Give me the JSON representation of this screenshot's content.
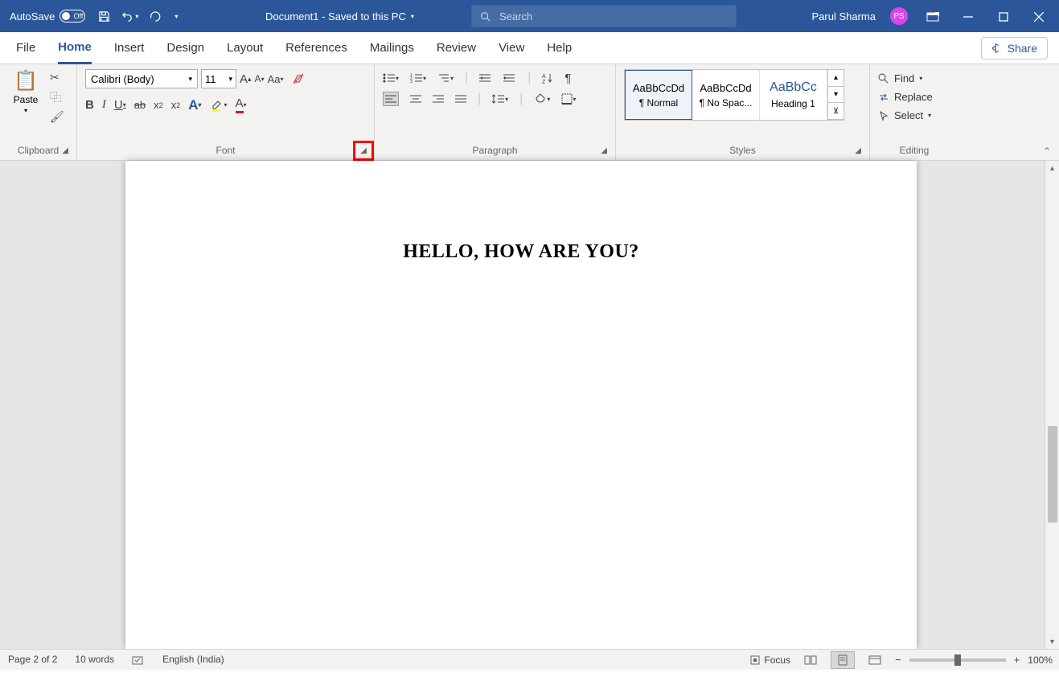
{
  "titlebar": {
    "autosave_label": "AutoSave",
    "autosave_state": "Off",
    "document_title": "Document1 - Saved to this PC",
    "search_placeholder": "Search",
    "user_name": "Parul Sharma",
    "user_initials": "PS"
  },
  "tabs": {
    "items": [
      "File",
      "Home",
      "Insert",
      "Design",
      "Layout",
      "References",
      "Mailings",
      "Review",
      "View",
      "Help"
    ],
    "active": "Home",
    "share_label": "Share"
  },
  "ribbon": {
    "clipboard": {
      "paste_label": "Paste",
      "group_label": "Clipboard"
    },
    "font": {
      "font_name": "Calibri (Body)",
      "font_size": "11",
      "group_label": "Font"
    },
    "paragraph": {
      "group_label": "Paragraph"
    },
    "styles": {
      "group_label": "Styles",
      "items": [
        {
          "preview": "AaBbCcDd",
          "name": "¶ Normal",
          "selected": true
        },
        {
          "preview": "AaBbCcDd",
          "name": "¶ No Spac...",
          "selected": false
        },
        {
          "preview": "AaBbCc",
          "name": "Heading 1",
          "selected": false
        }
      ]
    },
    "editing": {
      "group_label": "Editing",
      "find_label": "Find",
      "replace_label": "Replace",
      "select_label": "Select"
    }
  },
  "document": {
    "body_text": "HELLO, HOW ARE YOU?"
  },
  "statusbar": {
    "page_info": "Page 2 of 2",
    "word_count": "10 words",
    "language": "English (India)",
    "focus_label": "Focus",
    "zoom_level": "100%"
  }
}
